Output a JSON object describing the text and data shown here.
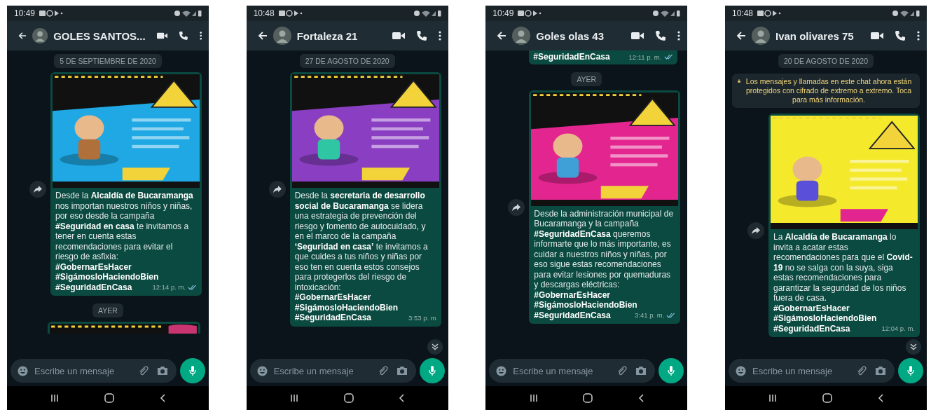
{
  "phones": [
    {
      "status_time": "10:49",
      "title": "GOLES SANTOS...",
      "scroll_down": false,
      "input_placeholder": "Escribe un mensaje",
      "items": [
        {
          "kind": "date",
          "text": "5 DE SEPTIEMBRE DE 2020"
        },
        {
          "kind": "message",
          "caption": "Desde la **Alcaldía de Bucaramanga** nos importan nuestros niños y niñas, por eso desde la campaña **#Seguridad en casa** te invitamos a tener en cuenta estas recomendaciones para evitar el riesgo de asfixia:",
          "hashtags": [
            "#GobernarEsHacer",
            "#SigámosloHaciendoBien",
            "#SeguridadEnCasa"
          ],
          "time": "12:14 p. m.",
          "ticks": true
        },
        {
          "kind": "date",
          "text": "AYER"
        },
        {
          "kind": "image_top"
        }
      ]
    },
    {
      "status_time": "10:48",
      "title": "Fortaleza 21",
      "scroll_down": true,
      "input_placeholder": "Escribe un mensaje",
      "items": [
        {
          "kind": "date",
          "text": "27 DE AGOSTO DE 2020"
        },
        {
          "kind": "message",
          "caption": "Desde la **secretaria de desarrollo social de Bucaramanga** se lidera una estrategia de prevención del riesgo y fomento de autocuidado, y en el marco de la campaña **‘Seguridad en casa’** te invitamos a que cuides a tus niños y niñas por eso ten en cuenta estos consejos para protegerlos del riesgo de intoxicación:",
          "hashtags": [
            "#GobernarEsHacer",
            "#SigámosloHaciendoBien",
            "#SeguridadEnCasa"
          ],
          "time": "3:53 p. m",
          "ticks": false
        }
      ]
    },
    {
      "status_time": "10:49",
      "title": "Goles olas 43",
      "scroll_down": false,
      "input_placeholder": "Escribe un mensaje",
      "items": [
        {
          "kind": "tail",
          "text": "#SeguridadEnCasa",
          "time": "12:11 p. m.",
          "ticks": true
        },
        {
          "kind": "date",
          "text": "AYER"
        },
        {
          "kind": "message",
          "caption": "Desde la administración municipal de Bucaramanga y la campaña **#SeguridadEnCasa** queremos informarte que lo más importante, es cuidar a nuestros niños y niñas, por eso sigue estas recomendaciones para evitar lesiones por quemaduras y descargas eléctricas:",
          "hashtags": [
            "#GobernarEsHacer",
            "#SigámosloHaciendoBien",
            "#SeguridadEnCasa"
          ],
          "time": "3:41 p. m.",
          "ticks": true
        }
      ]
    },
    {
      "status_time": "10:48",
      "title": "Ivan olivares 75",
      "scroll_down": true,
      "input_placeholder": "Escribe un mensaje",
      "items": [
        {
          "kind": "date",
          "text": "20 DE AGOSTO DE 2020"
        },
        {
          "kind": "notice",
          "text": "Los mensajes y llamadas en este chat ahora están protegidos con cifrado de extremo a extremo. Toca para más información."
        },
        {
          "kind": "message",
          "caption": "La **Alcaldía de Bucaramanga** lo invita a acatar estas recomendaciones para que el **Covid-19** no se salga con la suya, siga estas recomendaciones para garantizar la seguridad de los niños fuera de casa.",
          "hashtags": [
            "#GobernarEsHacer",
            "#SigámosloHaciendoBien",
            "#SeguridadEnCasa"
          ],
          "time": "12:04 p. m.",
          "ticks": false
        }
      ]
    }
  ]
}
